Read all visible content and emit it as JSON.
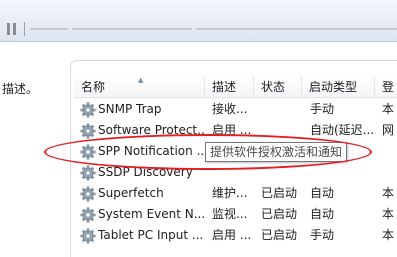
{
  "left_pane": {
    "description_label": "描述。"
  },
  "columns": {
    "name": "名称",
    "description": "描述",
    "status": "状态",
    "startup_type": "启动类型",
    "logon_as": "登"
  },
  "services": [
    {
      "name": "SNMP Trap",
      "description": "接收...",
      "status": "",
      "startup_type": "手动",
      "logon_as": "本"
    },
    {
      "name": "Software Protect...",
      "description": "启用 ...",
      "status": "",
      "startup_type": "自动(延迟...",
      "logon_as": "网"
    },
    {
      "name": "SPP Notification ...",
      "description": "",
      "status": "",
      "startup_type": "",
      "logon_as": ""
    },
    {
      "name": "SSDP Discovery",
      "description": "",
      "status": "",
      "startup_type": "",
      "logon_as": ""
    },
    {
      "name": "Superfetch",
      "description": "维护...",
      "status": "已启动",
      "startup_type": "自动",
      "logon_as": "本"
    },
    {
      "name": "System Event N...",
      "description": "监视...",
      "status": "已启动",
      "startup_type": "自动",
      "logon_as": "本"
    },
    {
      "name": "Tablet PC Input ...",
      "description": "启用 ...",
      "status": "已启动",
      "startup_type": "手动",
      "logon_as": "本"
    }
  ],
  "tooltip": {
    "text": "提供软件授权激活和通知"
  },
  "annotation_color": "#e31e24"
}
